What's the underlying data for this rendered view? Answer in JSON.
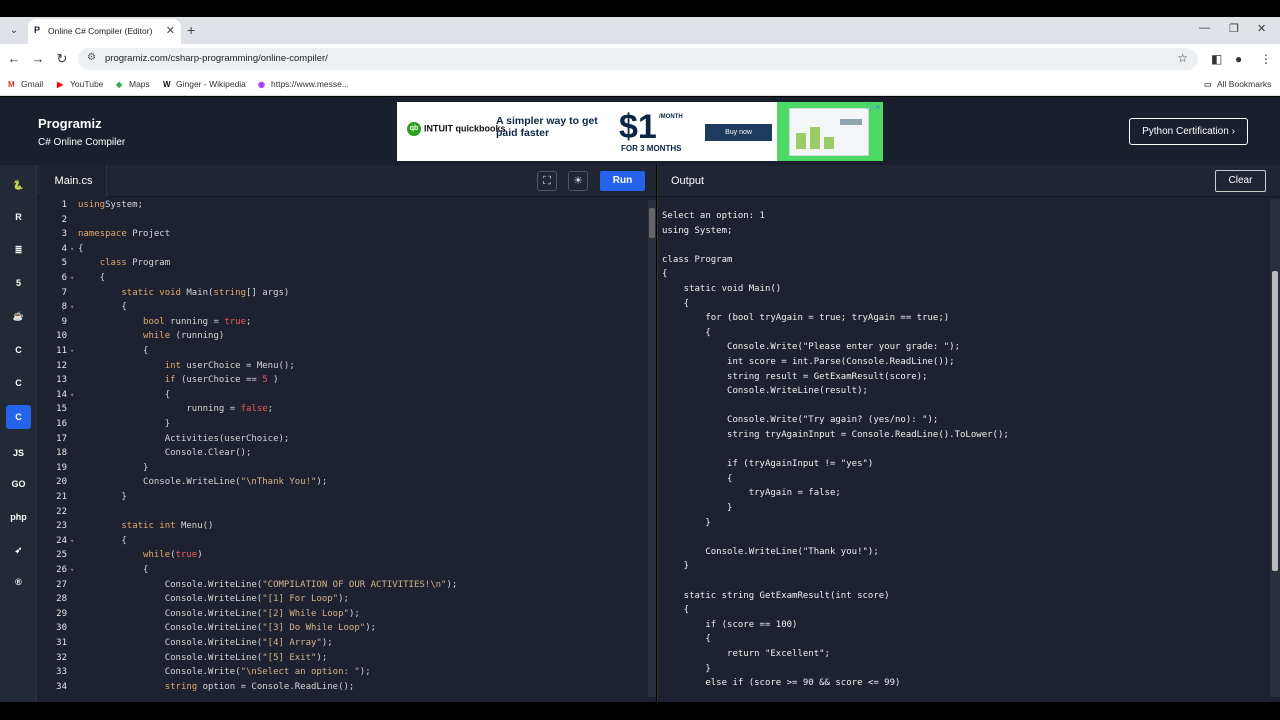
{
  "browser": {
    "tab_title": "Online C# Compiler (Editor)",
    "url": "programiz.com/csharp-programming/online-compiler/",
    "bookmarks": [
      {
        "label": "Gmail",
        "icon": "gmail-icon"
      },
      {
        "label": "YouTube",
        "icon": "youtube-icon"
      },
      {
        "label": "Maps",
        "icon": "maps-icon"
      },
      {
        "label": "Ginger - Wikipedia",
        "icon": "wikipedia-icon"
      },
      {
        "label": "https://www.messe...",
        "icon": "messenger-icon"
      }
    ],
    "all_bookmarks": "All Bookmarks"
  },
  "header": {
    "logo": "Programiz",
    "subtitle": "C# Online Compiler",
    "certification_button": "Python Certification ›",
    "ad": {
      "brand": "INTUIT quickbooks",
      "tagline": "A simpler way to get paid faster",
      "price": "$1",
      "per": "/MONTH",
      "duration": "FOR 3 MONTHS",
      "cta": "Buy now"
    }
  },
  "languages": [
    "python",
    "r",
    "sql",
    "html",
    "java",
    "c",
    "cpp",
    "csharp",
    "js",
    "go",
    "php",
    "swift",
    "rust"
  ],
  "editor": {
    "filename": "Main.cs",
    "run_label": "Run"
  },
  "output": {
    "title": "Output",
    "clear_label": "Clear",
    "lines": [
      "Select an option: 1",
      "using System;",
      "",
      "class Program",
      "{",
      "    static void Main()",
      "    {",
      "        for (bool tryAgain = true; tryAgain == true;)",
      "        {",
      "            Console.Write(\"Please enter your grade: \");",
      "            int score = int.Parse(Console.ReadLine());",
      "            string result = GetExamResult(score);",
      "            Console.WriteLine(result);",
      "",
      "            Console.Write(\"Try again? (yes/no): \");",
      "            string tryAgainInput = Console.ReadLine().ToLower();",
      "",
      "            if (tryAgainInput != \"yes\")",
      "            {",
      "                tryAgain = false;",
      "            }",
      "        }",
      "",
      "        Console.WriteLine(\"Thank you!\");",
      "    }",
      "",
      "    static string GetExamResult(int score)",
      "    {",
      "        if (score == 100)",
      "        {",
      "            return \"Excellent\";",
      "        }",
      "        else if (score >= 90 && score <= 99)"
    ]
  },
  "code": [
    {
      "n": "1",
      "fold": "",
      "parts": [
        [
          "kw",
          "using"
        ],
        [
          "",
          "System;"
        ]
      ]
    },
    {
      "n": "2",
      "fold": "",
      "parts": []
    },
    {
      "n": "3",
      "fold": "",
      "parts": [
        [
          "kw",
          "namespace"
        ],
        [
          "",
          " Project"
        ]
      ]
    },
    {
      "n": "4",
      "fold": "▾",
      "parts": [
        [
          "",
          "{"
        ]
      ]
    },
    {
      "n": "5",
      "fold": "",
      "parts": [
        [
          "",
          "    "
        ],
        [
          "kw",
          "class"
        ],
        [
          "",
          " Program"
        ]
      ]
    },
    {
      "n": "6",
      "fold": "▾",
      "parts": [
        [
          "",
          "    {"
        ]
      ]
    },
    {
      "n": "7",
      "fold": "",
      "parts": [
        [
          "",
          "        "
        ],
        [
          "kw",
          "static void"
        ],
        [
          "",
          " Main("
        ],
        [
          "ty",
          "string"
        ],
        [
          "",
          "[] args)"
        ]
      ]
    },
    {
      "n": "8",
      "fold": "▾",
      "parts": [
        [
          "",
          "        {"
        ]
      ]
    },
    {
      "n": "9",
      "fold": "",
      "parts": [
        [
          "",
          "            "
        ],
        [
          "kw",
          "bool"
        ],
        [
          "",
          " running = "
        ],
        [
          "lit",
          "true"
        ],
        [
          "",
          ";"
        ]
      ]
    },
    {
      "n": "10",
      "fold": "",
      "parts": [
        [
          "",
          "            "
        ],
        [
          "kw",
          "while"
        ],
        [
          "",
          " (running)"
        ]
      ]
    },
    {
      "n": "11",
      "fold": "▾",
      "parts": [
        [
          "",
          "            {"
        ]
      ]
    },
    {
      "n": "12",
      "fold": "",
      "parts": [
        [
          "",
          "                "
        ],
        [
          "kw",
          "int"
        ],
        [
          "",
          " userChoice = Menu();"
        ]
      ]
    },
    {
      "n": "13",
      "fold": "",
      "parts": [
        [
          "",
          "                "
        ],
        [
          "kw",
          "if"
        ],
        [
          "",
          " (userChoice == "
        ],
        [
          "lit",
          "5"
        ],
        [
          "",
          " )"
        ]
      ]
    },
    {
      "n": "14",
      "fold": "▾",
      "parts": [
        [
          "",
          "                {"
        ]
      ]
    },
    {
      "n": "15",
      "fold": "",
      "parts": [
        [
          "",
          "                    running = "
        ],
        [
          "lit",
          "false"
        ],
        [
          "",
          ";"
        ]
      ]
    },
    {
      "n": "16",
      "fold": "",
      "parts": [
        [
          "",
          "                }"
        ]
      ]
    },
    {
      "n": "17",
      "fold": "",
      "parts": [
        [
          "",
          "                Activities(userChoice);"
        ]
      ]
    },
    {
      "n": "18",
      "fold": "",
      "parts": [
        [
          "",
          "                Console.Clear();"
        ]
      ]
    },
    {
      "n": "19",
      "fold": "",
      "parts": [
        [
          "",
          "            }"
        ]
      ]
    },
    {
      "n": "20",
      "fold": "",
      "parts": [
        [
          "",
          "            Console.WriteLine("
        ],
        [
          "str",
          "\"\\nThank You!\""
        ],
        [
          "",
          ");"
        ]
      ]
    },
    {
      "n": "21",
      "fold": "",
      "parts": [
        [
          "",
          "        }"
        ]
      ]
    },
    {
      "n": "22",
      "fold": "",
      "parts": []
    },
    {
      "n": "23",
      "fold": "",
      "parts": [
        [
          "",
          "        "
        ],
        [
          "kw",
          "static int"
        ],
        [
          "",
          " Menu()"
        ]
      ]
    },
    {
      "n": "24",
      "fold": "▾",
      "parts": [
        [
          "",
          "        {"
        ]
      ]
    },
    {
      "n": "25",
      "fold": "",
      "parts": [
        [
          "",
          "            "
        ],
        [
          "kw",
          "while"
        ],
        [
          "",
          "("
        ],
        [
          "lit",
          "true"
        ],
        [
          "",
          ")"
        ]
      ]
    },
    {
      "n": "26",
      "fold": "▾",
      "parts": [
        [
          "",
          "            {"
        ]
      ]
    },
    {
      "n": "27",
      "fold": "",
      "parts": [
        [
          "",
          "                Console.WriteLine("
        ],
        [
          "str",
          "\"COMPILATION OF OUR ACTIVITIES!\\n\""
        ],
        [
          "",
          ");"
        ]
      ]
    },
    {
      "n": "28",
      "fold": "",
      "parts": [
        [
          "",
          "                Console.WriteLine("
        ],
        [
          "str",
          "\"[1] For Loop\""
        ],
        [
          "",
          ");"
        ]
      ]
    },
    {
      "n": "29",
      "fold": "",
      "parts": [
        [
          "",
          "                Console.WriteLine("
        ],
        [
          "str",
          "\"[2] While Loop\""
        ],
        [
          "",
          ");"
        ]
      ]
    },
    {
      "n": "30",
      "fold": "",
      "parts": [
        [
          "",
          "                Console.WriteLine("
        ],
        [
          "str",
          "\"[3] Do While Loop\""
        ],
        [
          "",
          ");"
        ]
      ]
    },
    {
      "n": "31",
      "fold": "",
      "parts": [
        [
          "",
          "                Console.WriteLine("
        ],
        [
          "str",
          "\"[4] Array\""
        ],
        [
          "",
          ");"
        ]
      ]
    },
    {
      "n": "32",
      "fold": "",
      "parts": [
        [
          "",
          "                Console.WriteLine("
        ],
        [
          "str",
          "\"[5] Exit\""
        ],
        [
          "",
          ");"
        ]
      ]
    },
    {
      "n": "33",
      "fold": "",
      "parts": [
        [
          "",
          "                Console.Write("
        ],
        [
          "str",
          "\"\\nSelect an option: \""
        ],
        [
          "",
          ");"
        ]
      ]
    },
    {
      "n": "34",
      "fold": "",
      "parts": [
        [
          "",
          "                "
        ],
        [
          "kw",
          "string"
        ],
        [
          "",
          " option = Console.ReadLine();"
        ]
      ]
    }
  ]
}
